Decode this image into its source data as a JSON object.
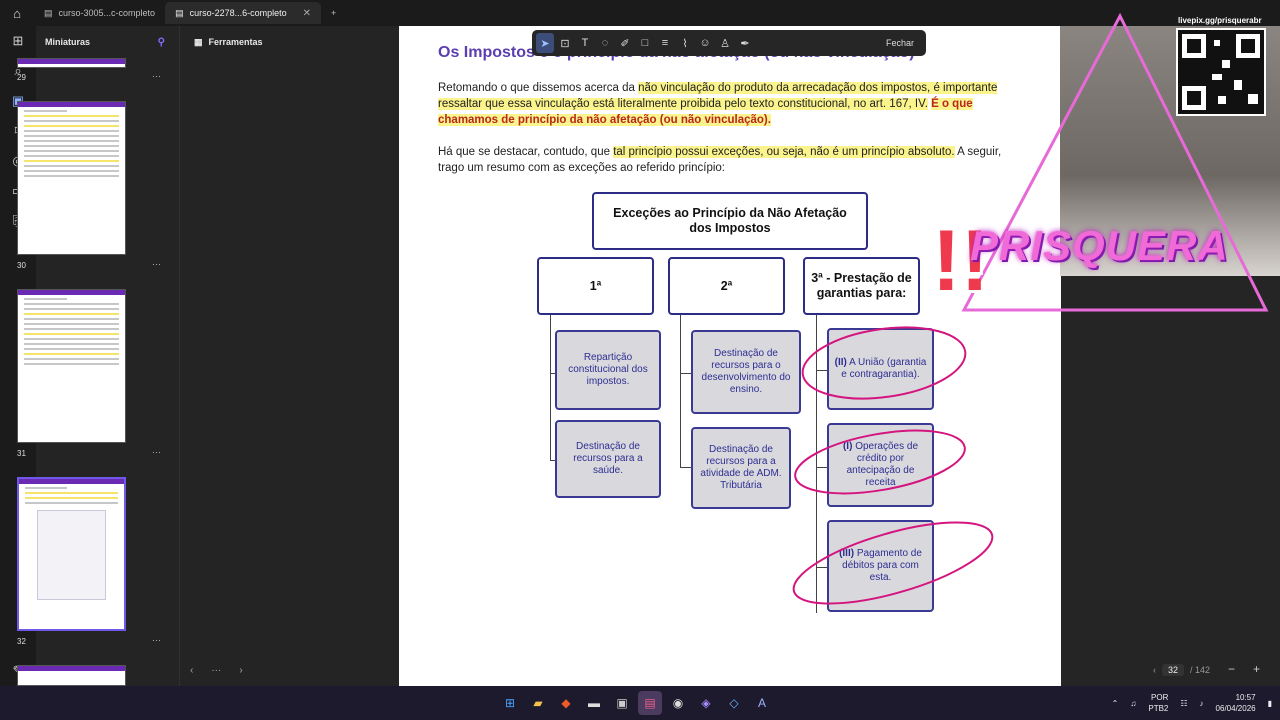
{
  "tabs": [
    {
      "label": "curso-3005...c-completo"
    },
    {
      "label": "curso-2278...6-completo"
    }
  ],
  "sidebar": {
    "title": "Miniaturas",
    "thumb_numbers": [
      "29",
      "30",
      "31",
      "32"
    ]
  },
  "tools_panel": {
    "title": "Ferramentas"
  },
  "toolbar": {
    "close_label": "Fechar"
  },
  "document": {
    "heading": "Os Impostos e o princípio da não afetação (ou não vinculação)",
    "p1_a": "Retomando o que dissemos acerca da ",
    "p1_hl": "não vinculação do produto da arrecadação dos impostos, é importante ressaltar que essa vinculação está literalmente proibida pelo texto constitucional, no art. 167, IV.",
    "p1_bold": "É o que chamamos de princípio da não afetação (ou não vinculação).",
    "p2_a": "Há que se destacar, contudo, que ",
    "p2_hl": "tal princípio possui exceções, ou seja, não é um princípio absoluto.",
    "p2_b": " A seguir, trago um resumo com as exceções ao referido princípio:",
    "diagram": {
      "title": "Exceções ao Princípio da Não Afetação dos Impostos",
      "col1": "1ª",
      "col2": "2ª",
      "col3": "3ª - Prestação de garantias para:",
      "c1a": "Repartição constitucional dos impostos.",
      "c1b": "Destinação de recursos para a saúde.",
      "c2a": "Destinação de recursos para o desenvolvimento do ensino.",
      "c2b": "Destinação de recursos para a atividade de ADM. Tributária",
      "c3a_num": "(II)",
      "c3a": " A União (garantia e contragarantia).",
      "c3b_num": "(I)",
      "c3b": " Operações de crédito por antecipação de receita",
      "c3c_num": "(III)",
      "c3c": " Pagamento de débitos para com esta."
    }
  },
  "stream": {
    "qr_label": "livepix.gg/prisquerabr",
    "overlay_name": "PRISQUERA"
  },
  "pager": {
    "current": "32",
    "total": "/ 142"
  },
  "taskbar": {
    "lang": "POR",
    "layout": "PTB2",
    "time": "10:57",
    "date": "06/04/2026"
  }
}
